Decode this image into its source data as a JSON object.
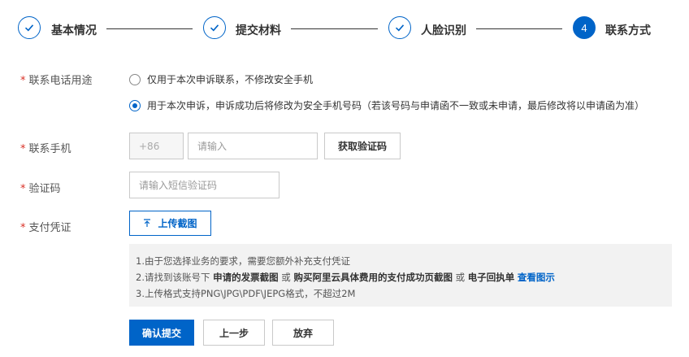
{
  "steps": [
    {
      "label": "基本情况",
      "state": "done"
    },
    {
      "label": "提交材料",
      "state": "done"
    },
    {
      "label": "人脸识别",
      "state": "done"
    },
    {
      "label": "联系方式",
      "state": "active",
      "number": "4"
    }
  ],
  "form": {
    "purpose": {
      "label": "联系电话用途",
      "options": [
        {
          "text": "仅用于本次申诉联系，不修改安全手机",
          "checked": false
        },
        {
          "text": "用于本次申诉，申诉成功后将修改为安全手机号码（若该号码与申请函不一致或未申请，最后修改将以申请函为准）",
          "checked": true
        }
      ]
    },
    "phone": {
      "label": "联系手机",
      "prefix": "+86",
      "placeholder": "请输入",
      "get_code_button": "获取验证码"
    },
    "code": {
      "label": "验证码",
      "placeholder": "请输入短信验证码"
    },
    "proof": {
      "label": "支付凭证",
      "upload_button": "上传截图"
    },
    "required_mark": "*"
  },
  "notice": {
    "line1": "1.由于您选择业务的要求，需要您额外补充支付凭证",
    "line2_a": "2.请找到该账号下 ",
    "line2_b": "申请的发票截图",
    "line2_c": " 或 ",
    "line2_d": "购买阿里云具体费用的支付成功页截图",
    "line2_e": " 或 ",
    "line2_f": "电子回执单",
    "line2_link": "查看图示",
    "line3": "3.上传格式支持PNG\\JPG\\PDF\\JEPG格式，不超过2M"
  },
  "actions": {
    "submit": "确认提交",
    "prev": "上一步",
    "abandon": "放弃"
  },
  "colors": {
    "accent": "#0064c8",
    "required": "#d93026",
    "notice_bg": "#f2f2f2"
  }
}
